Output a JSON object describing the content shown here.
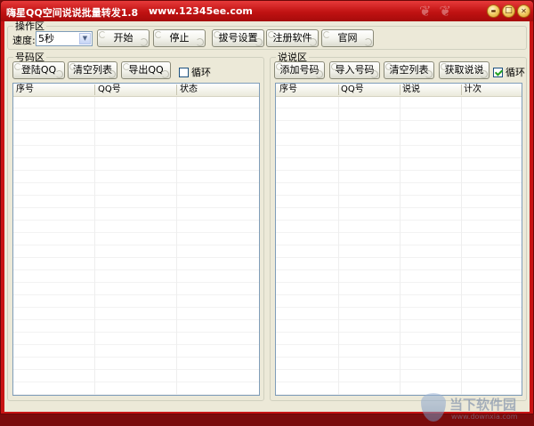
{
  "window": {
    "title": "嗨星QQ空间说说批量转发1.8",
    "url": "www.12345ee.com"
  },
  "controls": {
    "minimize_glyph": "▬",
    "maximize_glyph": "□",
    "close_glyph": "✕"
  },
  "ops": {
    "legend": "操作区",
    "speed_label": "速度:",
    "speed_value": "5秒",
    "start": "开始",
    "stop": "停止",
    "dial_settings": "拔号设置",
    "register": "注册软件",
    "website": "官网"
  },
  "accounts": {
    "legend": "号码区",
    "login": "登陆QQ",
    "clear": "清空列表",
    "export": "导出QQ",
    "loop_label": "循环",
    "loop_checked": false,
    "columns": [
      "序号",
      "QQ号",
      "状态"
    ]
  },
  "posts": {
    "legend": "说说区",
    "add_number": "添加号码",
    "import_number": "导入号码",
    "clear": "清空列表",
    "fetch": "获取说说",
    "loop_label": "循环",
    "loop_checked": true,
    "columns": [
      "序号",
      "QQ号",
      "说说",
      "计次"
    ]
  },
  "watermark": {
    "text": "当下软件园",
    "sub": "www.downxia.com"
  }
}
